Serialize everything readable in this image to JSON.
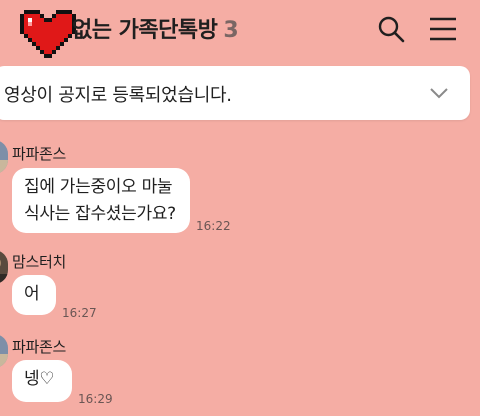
{
  "header": {
    "title": "없는 가족단톡방",
    "member_count": "3",
    "logo_icon": "pixel-heart-icon",
    "search_icon": "search-icon",
    "menu_icon": "hamburger-menu-icon"
  },
  "notice": {
    "text": "영상이 공지로 등록되었습니다.",
    "expand_icon": "chevron-down-icon"
  },
  "messages": [
    {
      "sender": "파파존스",
      "lines": [
        "집에 가는중이오 마눌",
        "식사는 잡수셨는가요?"
      ],
      "time": "16:22"
    },
    {
      "sender": "맘스터치",
      "lines": [
        "어"
      ],
      "time": "16:27"
    },
    {
      "sender": "파파존스",
      "lines": [
        "넹♡"
      ],
      "time": "16:29"
    }
  ],
  "colors": {
    "background": "#f5ada4",
    "bubble": "#ffffff",
    "heart": "#e01818"
  }
}
